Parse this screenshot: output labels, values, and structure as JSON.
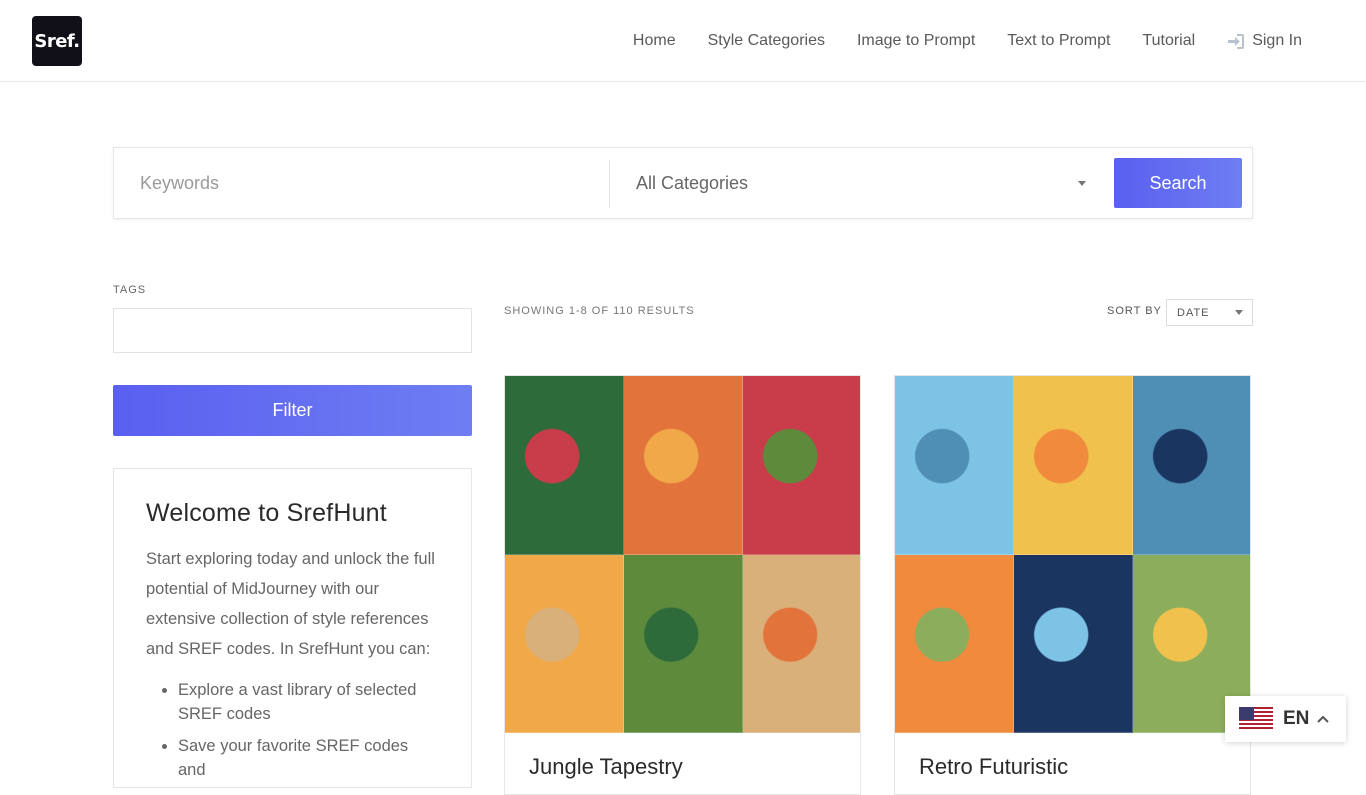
{
  "header": {
    "logo_text": "Sref.",
    "nav": [
      {
        "label": "Home"
      },
      {
        "label": "Style Categories"
      },
      {
        "label": "Image to Prompt"
      },
      {
        "label": "Text to Prompt"
      },
      {
        "label": "Tutorial"
      }
    ],
    "signin_label": "Sign In",
    "signin_icon": "sign-in-icon"
  },
  "search": {
    "keywords_placeholder": "Keywords",
    "keywords_value": "",
    "category_selected": "All Categories",
    "button_label": "Search"
  },
  "sidebar": {
    "tags_label": "TAGS",
    "tags_value": "",
    "filter_label": "Filter",
    "welcome": {
      "title": "Welcome to SrefHunt",
      "body": "Start exploring today and unlock the full potential of MidJourney with our extensive collection of style references and SREF codes. In SrefHunt you can:",
      "bullets": [
        "Explore a vast library of selected SREF codes",
        "Save your favorite SREF codes and"
      ]
    }
  },
  "results": {
    "count_text": "SHOWING 1-8 OF 110 RESULTS",
    "sort_label": "SORT BY",
    "sort_value": "DATE"
  },
  "cards": [
    {
      "title": "Jungle Tapestry",
      "palette": [
        "#2e6b3a",
        "#e2743b",
        "#c93c4a",
        "#f1a849",
        "#5e8a3c",
        "#d9b07a"
      ]
    },
    {
      "title": "Retro Futuristic",
      "palette": [
        "#7cc3e6",
        "#f0c14c",
        "#4f8fb5",
        "#f08a3c",
        "#1a3560",
        "#8cae5c"
      ]
    }
  ],
  "language": {
    "code": "EN",
    "flag": "us-flag-icon"
  },
  "colors": {
    "accent": "#5a5ff0",
    "accent_end": "#6e7ef2",
    "logo_bg": "#111018"
  }
}
